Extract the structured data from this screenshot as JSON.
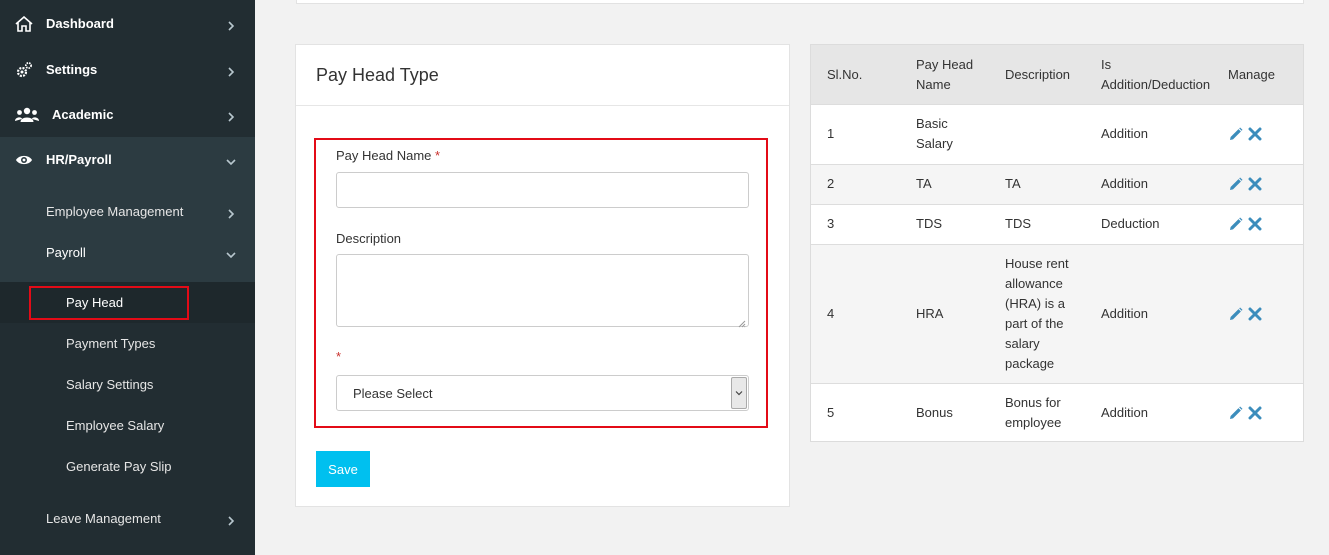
{
  "sidebar": {
    "items": [
      {
        "label": "Dashboard",
        "icon": "home-icon"
      },
      {
        "label": "Settings",
        "icon": "gears-icon"
      },
      {
        "label": "Academic",
        "icon": "users-icon"
      },
      {
        "label": "HR/Payroll",
        "icon": "eye-icon"
      }
    ],
    "hr_sub": [
      {
        "label": "Employee Management"
      },
      {
        "label": "Payroll"
      }
    ],
    "payroll_sub": [
      {
        "label": "Pay Head"
      },
      {
        "label": "Payment Types"
      },
      {
        "label": "Salary Settings"
      },
      {
        "label": "Employee Salary"
      },
      {
        "label": "Generate Pay Slip"
      }
    ],
    "leave": {
      "label": "Leave Management"
    }
  },
  "form": {
    "title": "Pay Head Type",
    "name_label": "Pay Head Name",
    "required_mark": "*",
    "description_label": "Description",
    "select_value": "Please Select",
    "save_label": "Save"
  },
  "table": {
    "headers": [
      "Sl.No.",
      "Pay Head Name",
      "Description",
      "Is Addition/Deduction",
      "Manage"
    ],
    "rows": [
      {
        "no": "1",
        "name": "Basic Salary",
        "description": "",
        "type": "Addition"
      },
      {
        "no": "2",
        "name": "TA",
        "description": "TA",
        "type": "Addition"
      },
      {
        "no": "3",
        "name": "TDS",
        "description": "TDS",
        "type": "Deduction"
      },
      {
        "no": "4",
        "name": "HRA",
        "description": "House rent allowance (HRA) is a part of the salary package",
        "type": "Addition"
      },
      {
        "no": "5",
        "name": "Bonus",
        "description": "Bonus for employee",
        "type": "Addition"
      }
    ]
  },
  "colors": {
    "sidebar_bg": "#222d32",
    "accent": "#00c0ef",
    "highlight": "#e30b17",
    "icon_blue": "#3c8dbc"
  }
}
